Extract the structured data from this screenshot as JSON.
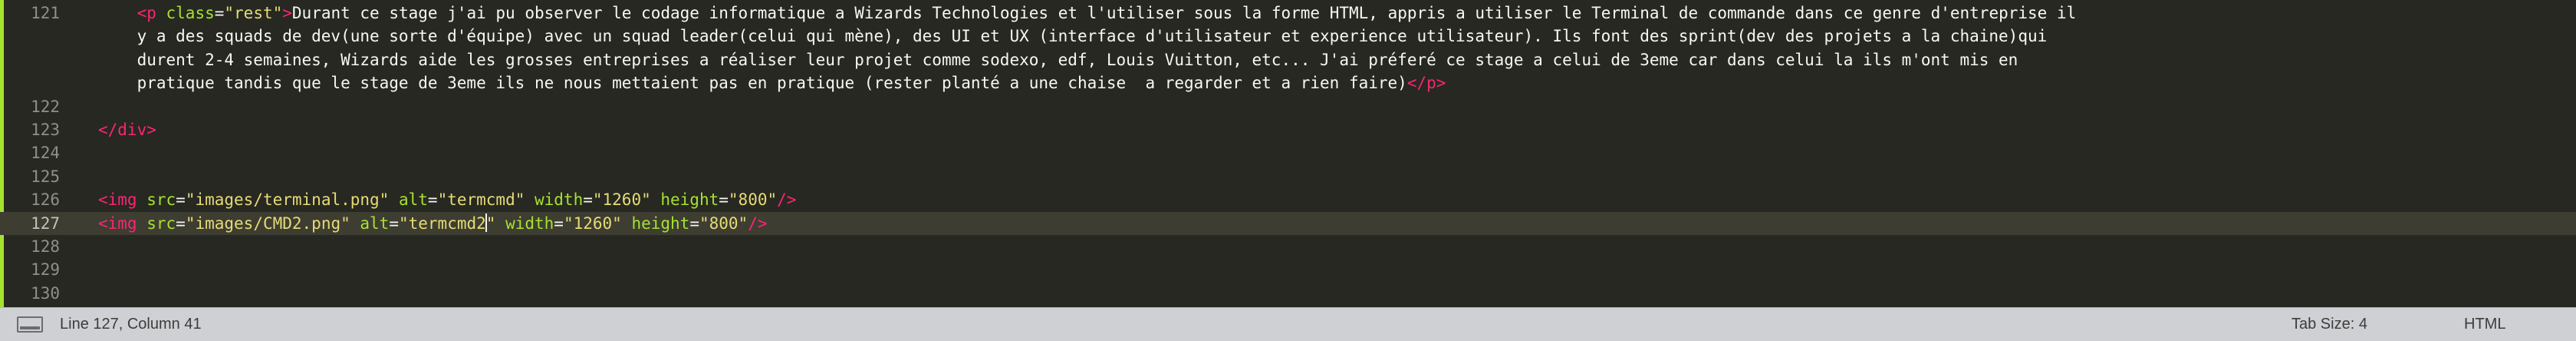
{
  "editor": {
    "lines": [
      {
        "number": "121",
        "segments": [
          {
            "text": "    ",
            "type": "txt"
          },
          {
            "text": "<p",
            "type": "tag"
          },
          {
            "text": " class",
            "type": "attr"
          },
          {
            "text": "=",
            "type": "txt"
          },
          {
            "text": "\"rest\"",
            "type": "str"
          },
          {
            "text": ">",
            "type": "tag"
          },
          {
            "text": "Durant ce stage j'ai pu observer le codage informatique a Wizards Technologies et l'utiliser sous la forme HTML, appris a utiliser le Terminal de commande dans ce genre d'entreprise il",
            "type": "txt"
          }
        ]
      },
      {
        "number": "",
        "segments": [
          {
            "text": "    y a des squads de dev(une sorte d'équipe) avec un squad leader(celui qui mène), des UI et UX (interface d'utilisateur et experience utilisateur). Ils font des sprint(dev des projets a la chaine)qui",
            "type": "txt"
          }
        ]
      },
      {
        "number": "",
        "segments": [
          {
            "text": "    durent 2-4 semaines, Wizards aide les grosses entreprises a réaliser leur projet comme sodexo, edf, Louis Vuitton, etc... J'ai préferé ce stage a celui de 3eme car dans celui la ils m'ont mis en",
            "type": "txt"
          }
        ]
      },
      {
        "number": "",
        "segments": [
          {
            "text": "    pratique tandis que le stage de 3eme ils ne nous mettaient pas en pratique (rester planté a une chaise  a regarder et a rien faire)",
            "type": "txt"
          },
          {
            "text": "</p>",
            "type": "tag"
          }
        ]
      },
      {
        "number": "122",
        "segments": []
      },
      {
        "number": "123",
        "segments": [
          {
            "text": "</div>",
            "type": "tag"
          }
        ]
      },
      {
        "number": "124",
        "segments": []
      },
      {
        "number": "125",
        "segments": []
      },
      {
        "number": "126",
        "segments": [
          {
            "text": "<img",
            "type": "tag"
          },
          {
            "text": " src",
            "type": "attr"
          },
          {
            "text": "=",
            "type": "txt"
          },
          {
            "text": "\"images/terminal.png\"",
            "type": "str"
          },
          {
            "text": " alt",
            "type": "attr"
          },
          {
            "text": "=",
            "type": "txt"
          },
          {
            "text": "\"termcmd\"",
            "type": "str"
          },
          {
            "text": " width",
            "type": "attr"
          },
          {
            "text": "=",
            "type": "txt"
          },
          {
            "text": "\"1260\"",
            "type": "str"
          },
          {
            "text": " height",
            "type": "attr"
          },
          {
            "text": "=",
            "type": "txt"
          },
          {
            "text": "\"800\"",
            "type": "str"
          },
          {
            "text": "/>",
            "type": "tag"
          }
        ]
      },
      {
        "number": "127",
        "current": true,
        "segments": [
          {
            "text": "<img",
            "type": "tag"
          },
          {
            "text": " src",
            "type": "attr"
          },
          {
            "text": "=",
            "type": "txt"
          },
          {
            "text": "\"images/CMD2.png\"",
            "type": "str"
          },
          {
            "text": " alt",
            "type": "attr"
          },
          {
            "text": "=",
            "type": "txt"
          },
          {
            "text": "\"termcmd2",
            "type": "str"
          },
          {
            "cursor": true
          },
          {
            "text": "\"",
            "type": "str"
          },
          {
            "text": " width",
            "type": "attr"
          },
          {
            "text": "=",
            "type": "txt"
          },
          {
            "text": "\"1260\"",
            "type": "str"
          },
          {
            "text": " height",
            "type": "attr"
          },
          {
            "text": "=",
            "type": "txt"
          },
          {
            "text": "\"800\"",
            "type": "str"
          },
          {
            "text": "/>",
            "type": "tag"
          }
        ]
      },
      {
        "number": "128",
        "segments": []
      },
      {
        "number": "129",
        "segments": []
      },
      {
        "number": "130",
        "segments": []
      }
    ]
  },
  "status_bar": {
    "position": "Line 127, Column 41",
    "tab_size": "Tab Size: 4",
    "syntax": "HTML"
  }
}
